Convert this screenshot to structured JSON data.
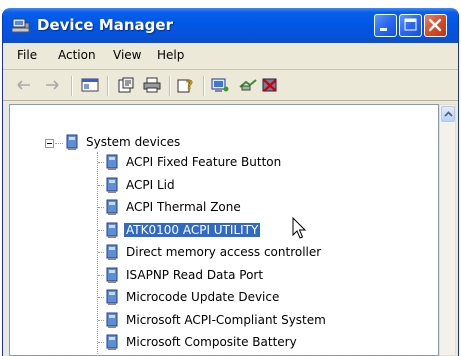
{
  "window": {
    "title": "Device Manager",
    "title_icon": "device-manager-icon"
  },
  "title_buttons": [
    "minimize",
    "maximize",
    "close"
  ],
  "menu": [
    {
      "label": "File"
    },
    {
      "label": "Action"
    },
    {
      "label": "View"
    },
    {
      "label": "Help"
    }
  ],
  "toolbar": [
    {
      "name": "back-arrow-icon"
    },
    {
      "name": "forward-arrow-icon"
    },
    {
      "name": "show-hide-console-tree-icon"
    },
    {
      "name": "properties-icon"
    },
    {
      "name": "print-icon"
    },
    {
      "name": "help-icon"
    },
    {
      "name": "scan-hardware-icon"
    },
    {
      "name": "update-driver-icon"
    },
    {
      "name": "uninstall-icon"
    }
  ],
  "tree": {
    "category": {
      "label": "System devices",
      "expanded": true
    },
    "items": [
      {
        "label": "ACPI Fixed Feature Button",
        "selected": false
      },
      {
        "label": "ACPI Lid",
        "selected": false
      },
      {
        "label": "ACPI Thermal Zone",
        "selected": false
      },
      {
        "label": "ATK0100 ACPI UTILITY",
        "selected": true
      },
      {
        "label": "Direct memory access controller",
        "selected": false
      },
      {
        "label": "ISAPNP Read Data Port",
        "selected": false
      },
      {
        "label": "Microcode Update Device",
        "selected": false
      },
      {
        "label": "Microsoft ACPI-Compliant System",
        "selected": false
      },
      {
        "label": "Microsoft Composite Battery",
        "selected": false
      }
    ]
  },
  "colors": {
    "selection": "#316ac5",
    "titlebar": "#0058e6",
    "chrome": "#ece9d8"
  }
}
